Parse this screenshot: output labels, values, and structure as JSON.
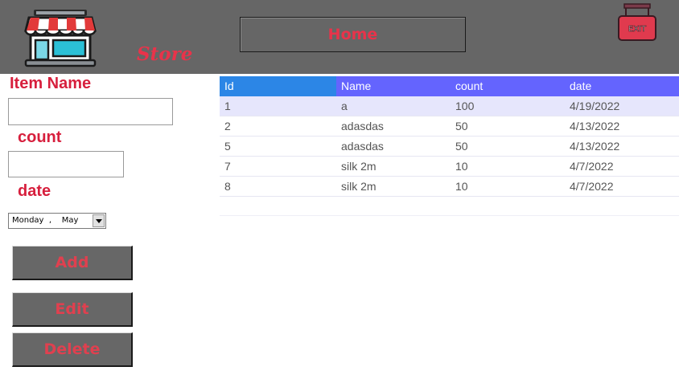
{
  "header": {
    "brand": "Store",
    "home_label": "Home",
    "exit_label": "EXIT",
    "icons": {
      "logo": "storefront-icon",
      "exit": "exit-sign-icon"
    },
    "colors": {
      "background": "#666666",
      "accent": "#e8334a"
    }
  },
  "form": {
    "item_name_label": "Item Name",
    "item_name_value": "",
    "count_label": "count",
    "count_value": "",
    "date_label": "date",
    "date_value": "Monday  ,    May"
  },
  "actions": {
    "add_label": "Add",
    "edit_label": "Edit",
    "delete_label": "Delete"
  },
  "grid": {
    "columns": [
      "Id",
      "Name",
      "count",
      "date"
    ],
    "rows": [
      [
        "1",
        "a",
        "100",
        "4/19/2022"
      ],
      [
        "2",
        "adasdas",
        "50",
        "4/13/2022"
      ],
      [
        "5",
        "adasdas",
        "50",
        "4/13/2022"
      ],
      [
        "7",
        "silk 2m",
        "10",
        "4/7/2022"
      ],
      [
        "8",
        "silk 2m",
        "10",
        "4/7/2022"
      ]
    ],
    "selected_row": 0,
    "colors": {
      "header": "#6464fe",
      "selected_header_cell": "#2c86e6",
      "selected_row": "#e6e6fc"
    }
  }
}
